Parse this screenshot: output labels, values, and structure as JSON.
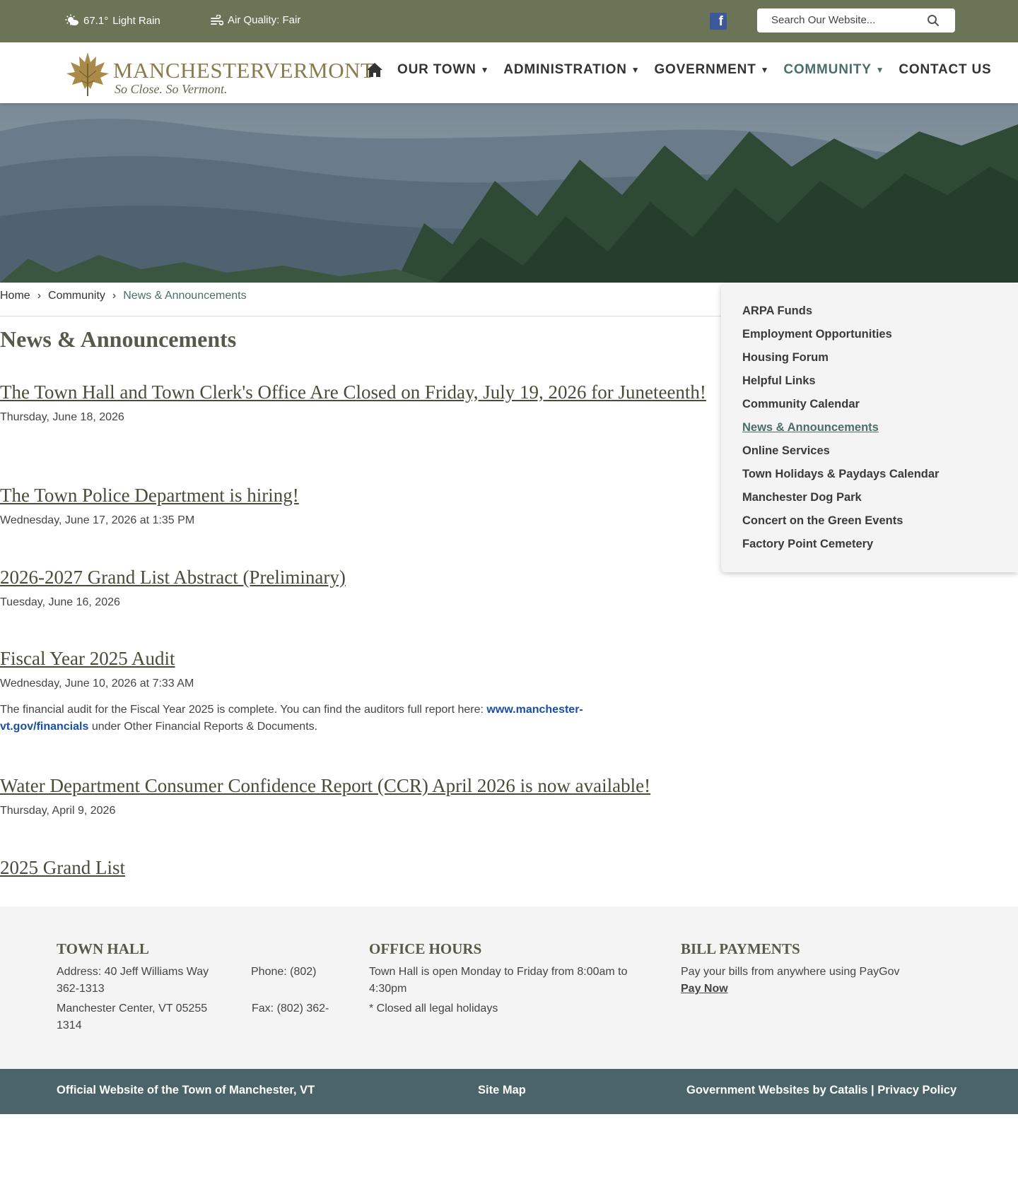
{
  "topbar": {
    "temperature": "67.1°",
    "condition": "Light Rain",
    "air_quality": "Air Quality: Fair",
    "search_placeholder": "Search Our Website..."
  },
  "logo": {
    "title": "MANCHESTERVERMONT",
    "tagline": "So Close. So Vermont."
  },
  "nav": {
    "items": [
      {
        "label": "OUR TOWN",
        "dropdown": true
      },
      {
        "label": "ADMINISTRATION",
        "dropdown": true
      },
      {
        "label": "GOVERNMENT",
        "dropdown": true
      },
      {
        "label": "COMMUNITY",
        "dropdown": true,
        "active": true
      },
      {
        "label": "CONTACT US",
        "dropdown": false
      }
    ]
  },
  "breadcrumb": [
    "Home",
    "Community",
    "News & Announcements"
  ],
  "page_title": "News & Announcements",
  "news": [
    {
      "title": "The Town Hall and Town Clerk's Office Are Closed on Friday, July 19, 2026 for Juneteenth!",
      "date": "Thursday, June 18, 2026"
    },
    {
      "title": "The Town Police Department is hiring!",
      "date": "Wednesday, June 17, 2026 at 1:35 PM"
    },
    {
      "title": "2026-2027 Grand List Abstract (Preliminary)",
      "date": "Tuesday, June 16, 2026"
    },
    {
      "title": "Fiscal Year 2025 Audit",
      "date": "Wednesday, June 10, 2026 at 7:33 AM",
      "body_before": "The financial audit for the Fiscal Year 2025 is complete. You can find the auditors full report here: ",
      "body_link": "www.manchester-vt.gov/financials",
      "body_after": " under Other Financial Reports & Documents."
    },
    {
      "title": "Water Department Consumer Confidence Report (CCR) April 2026 is now available!",
      "date": "Thursday, April 9, 2026"
    },
    {
      "title": "2025 Grand List",
      "date": ""
    }
  ],
  "sidebar": {
    "items": [
      "ARPA Funds",
      "Employment Opportunities",
      "Housing Forum",
      "Helpful Links",
      "Community Calendar",
      "News & Announcements",
      "Online Services",
      "Town Holidays & Paydays Calendar",
      "Manchester Dog Park",
      "Concert on the Green Events",
      "Factory Point Cemetery"
    ],
    "active_index": 5
  },
  "footer": {
    "town_hall": {
      "heading": "TOWN HALL",
      "address_line1": "Address: 40 Jeff Williams Way",
      "phone": "Phone: (802)",
      "phone_cont": "362-1313",
      "address_line2": "Manchester Center, VT 05255",
      "fax": "Fax: (802) 362-",
      "fax_cont": "1314"
    },
    "office_hours": {
      "heading": "OFFICE HOURS",
      "line1": "Town Hall is open Monday to Friday from 8:00am to 4:30pm",
      "line2": "* Closed all legal holidays"
    },
    "bill_payments": {
      "heading": "BILL PAYMENTS",
      "line1": "Pay your bills from anywhere using PayGov",
      "link": "Pay Now"
    }
  },
  "bottombar": {
    "official": "Official Website of the Town of Manchester, VT",
    "sitemap": "Site Map",
    "credit": "Government Websites by Catalis | Privacy Policy"
  },
  "colors": {
    "topbar": "#6c7457",
    "accent": "#4a6e68",
    "bottombar": "#4a6469",
    "link": "#1a4fa0"
  }
}
